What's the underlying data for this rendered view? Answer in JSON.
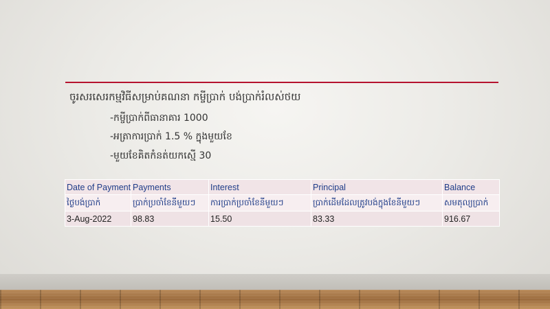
{
  "slide": {
    "heading": "ចូរសរសេរកម្មវិធីសម្រាប់គណនា  កម្ចីប្រាក់ បង់ប្រាក់រំលស់ថយ",
    "bullets": [
      "-កម្ចីប្រាក់ពីធានាគារ  1000",
      "-អត្រាការប្រាក់  1.5 % ក្នុងមួយខែ",
      "-មួយខែគិតកំនត់យកស្មើ  30"
    ]
  },
  "table": {
    "columns": [
      "Date of Payment",
      "Payments",
      "Interest",
      "Principal",
      "Balance"
    ],
    "columns_khmer": [
      "ថ្ងៃបង់ប្រាក់",
      "ប្រាក់ប្រចាំខែនីមួយៗ",
      "ការប្រាក់ប្រចាំខែនីមួយៗ",
      "ប្រាក់ដើមដែលត្រូវបង់ក្នុងខែនីមួយៗ",
      "សមតុល្យប្រាក់"
    ],
    "rows": [
      [
        "3-Aug-2022",
        "98.83",
        "15.50",
        "83.33",
        "916.67"
      ]
    ]
  },
  "colors": {
    "accent_rule": "#b5122e",
    "header_text": "#1f3c88",
    "table_fill": "#f3e6e9"
  }
}
